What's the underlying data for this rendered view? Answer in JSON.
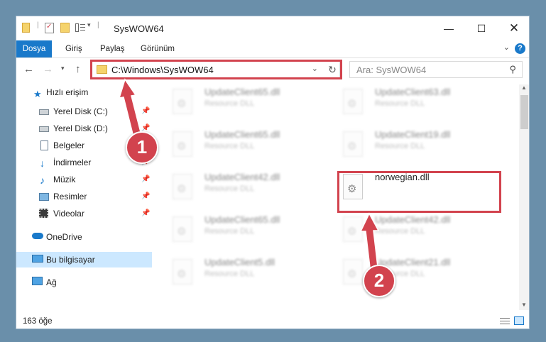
{
  "window": {
    "title": "SysWOW64"
  },
  "ribbon": {
    "tabs": [
      "Dosya",
      "Giriş",
      "Paylaş",
      "Görünüm"
    ],
    "help_label": "?"
  },
  "navigation": {
    "address_path": "C:\\Windows\\SysWOW64",
    "search_placeholder": "Ara: SysWOW64"
  },
  "sidebar": {
    "quick_access": "Hızlı erişim",
    "items": [
      {
        "label": "Yerel Disk (C:)",
        "pinned": true
      },
      {
        "label": "Yerel Disk (D:)",
        "pinned": true
      },
      {
        "label": "Belgeler",
        "pinned": true
      },
      {
        "label": "İndirmeler",
        "pinned": true
      },
      {
        "label": "Müzik",
        "pinned": true
      },
      {
        "label": "Resimler",
        "pinned": true
      },
      {
        "label": "Videolar",
        "pinned": true
      }
    ],
    "onedrive": "OneDrive",
    "this_pc": "Bu bilgisayar",
    "network": "Ağ"
  },
  "files": [
    {
      "name": "UpdateClient65.dll",
      "type": "Resource DLL"
    },
    {
      "name": "UpdateClient63.dll",
      "type": "Resource DLL"
    },
    {
      "name": "UpdateClient65.dll",
      "type": "Resource DLL"
    },
    {
      "name": "UpdateClient19.dll",
      "type": "Resource DLL"
    },
    {
      "name": "UpdateClient42.dll",
      "type": "Resource DLL"
    },
    {
      "name": "norwegian.dll",
      "type": ""
    },
    {
      "name": "UpdateClient65.dll",
      "type": "Resource DLL"
    },
    {
      "name": "UpdateClient42.dll",
      "type": "Resource DLL"
    },
    {
      "name": "UpdateClient5.dll",
      "type": "Resource DLL"
    },
    {
      "name": "UpdateClient21.dll",
      "type": "Resource DLL"
    }
  ],
  "status": {
    "item_count": "163 öğe"
  },
  "annotations": {
    "marker1": "1",
    "marker2": "2",
    "accent_color": "#d2434e"
  }
}
